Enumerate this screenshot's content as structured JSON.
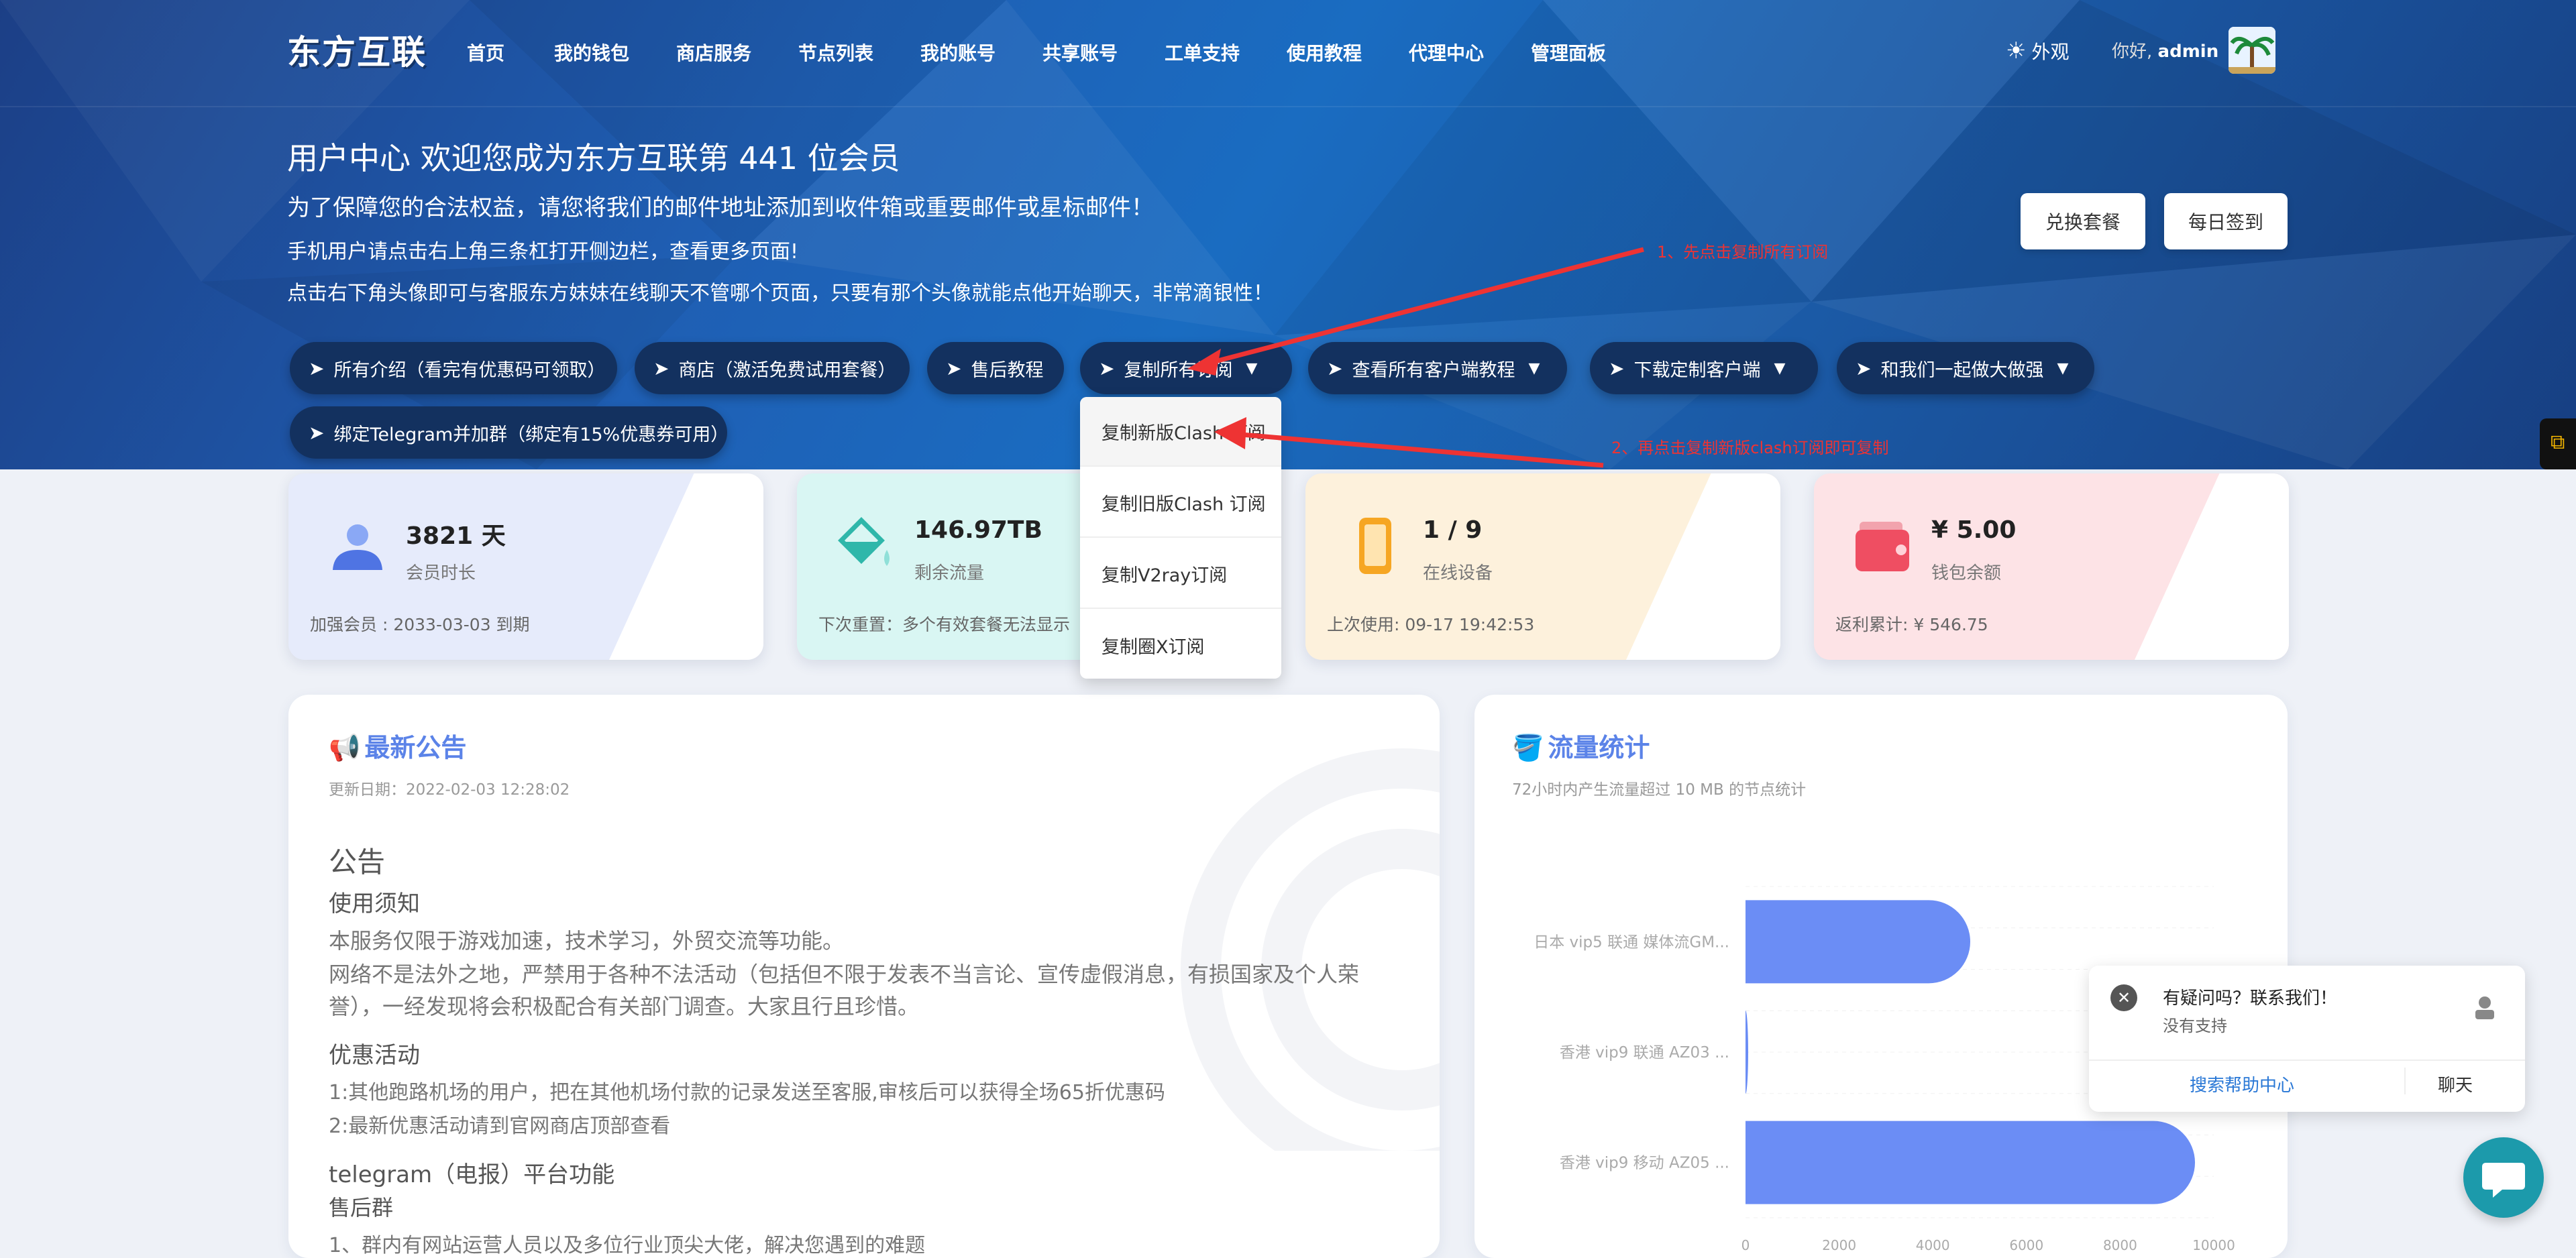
{
  "nav": {
    "logo": "东方互联",
    "items": [
      "首页",
      "我的钱包",
      "商店服务",
      "节点列表",
      "我的账号",
      "共享账号",
      "工单支持",
      "使用教程",
      "代理中心",
      "管理面板"
    ],
    "appearance": "外观",
    "greeting": "你好,",
    "username": "admin"
  },
  "hero": {
    "title": "用户中心 欢迎您成为东方互联第 441 位会员",
    "line1": "为了保障您的合法权益，请您将我们的邮件地址添加到收件箱或重要邮件或星标邮件！",
    "line2": "手机用户请点击右上角三条杠打开侧边栏，查看更多页面!",
    "line3": "点击右下角头像即可与客服东方妹妹在线聊天不管哪个页面，只要有那个头像就能点他开始聊天，非常滴银性！",
    "btn_exchange": "兑换套餐",
    "btn_checkin": "每日签到"
  },
  "pills": {
    "p1": "所有介绍（看完有优惠码可领取）",
    "p2": "商店（激活免费试用套餐）",
    "p3": "售后教程",
    "p4": "复制所有订阅",
    "p5": "查看所有客户端教程",
    "p6": "下载定制客户端",
    "p7": "和我们一起做大做强",
    "p8": "绑定Telegram并加群（绑定有15%优惠券可用）"
  },
  "dropdown": [
    "复制新版Clash 订阅",
    "复制旧版Clash 订阅",
    "复制V2ray订阅",
    "复制圈X订阅"
  ],
  "notes": {
    "n1": "1、先点击复制所有订阅",
    "n2": "2、再点击复制新版clash订阅即可复制"
  },
  "cards": [
    {
      "value": "3821 天",
      "label": "会员时长",
      "foot": "加强会员 : 2033-03-03 到期",
      "bg": "#e6ebfb"
    },
    {
      "value": "146.97TB",
      "label": "剩余流量",
      "foot": "下次重置：多个有效套餐无法显示",
      "bg": "#d9f6f3"
    },
    {
      "value": "1 / 9",
      "label": "在线设备",
      "foot": "上次使用: 09-17 19:42:53",
      "bg": "#fdf1dc"
    },
    {
      "value": "¥ 5.00",
      "label": "钱包余额",
      "foot": "返利累计: ¥ 546.75",
      "bg": "#fde3e6"
    }
  ],
  "announcement": {
    "title": "最新公告",
    "date": "更新日期：2022-02-03 12:28:02",
    "h_notice": "公告",
    "h_rules": "使用须知",
    "rule1": "本服务仅限于游戏加速，技术学习，外贸交流等功能。",
    "rule2a": "网络不是法外之地，严禁用于各种不法活动（包括但不限于发表不当言论、宣传虚假消息，有损国家及个人荣",
    "rule2b": "誉），一经发现将会积极配合有关部门调查。大家且行且珍惜。",
    "h_promo": "优惠活动",
    "promo1": "1:其他跑路机场的用户，把在其他机场付款的记录发送至客服,审核后可以获得全场65折优惠码",
    "promo2": "2:最新优惠活动请到官网商店顶部查看",
    "h_tg": "telegram（电报）平台功能",
    "tg_sub": "售后群",
    "tg_line": "1、群内有网站运营人员以及多位行业顶尖大佬，解决您遇到的难题"
  },
  "traffic": {
    "title": "流量统计",
    "subtitle": "72小时内产生流量超过 10 MB 的节点统计"
  },
  "chart_data": {
    "type": "bar",
    "orientation": "horizontal",
    "categories": [
      "日本 vip5 联通 媒体流GM...",
      "香港 vip9 联通 AZ03 ...",
      "香港 vip9 移动 AZ05 ..."
    ],
    "values": [
      4800,
      50,
      9600
    ],
    "xlim": [
      0,
      10000
    ],
    "xticks": [
      "0",
      "2000",
      "4000",
      "6000",
      "8000",
      "10000"
    ],
    "bar_color": "#6b8df5"
  },
  "chat": {
    "title": "有疑问吗？联系我们！",
    "status": "没有支持",
    "help": "搜索帮助中心",
    "talk": "聊天"
  }
}
